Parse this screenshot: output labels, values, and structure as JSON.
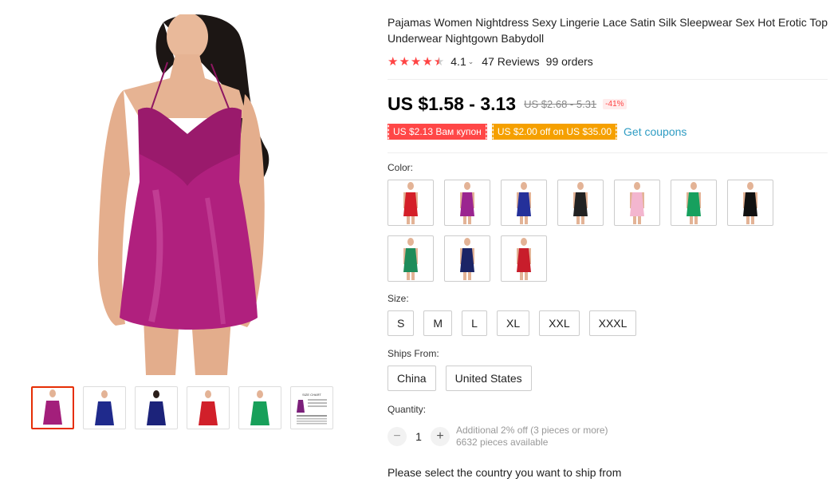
{
  "product": {
    "title": "Pajamas Women Nightdress Sexy Lingerie Lace Satin Silk Sleepwear Sex Hot Erotic Top Underwear Nightgown Babydoll",
    "rating": "4.1",
    "reviews": "47 Reviews",
    "orders": "99 orders",
    "rating_stars_fraction": 0.82,
    "price": "US $1.58 - 3.13",
    "old_price": "US $2.68 - 5.31",
    "discount": "-41%",
    "coupons": [
      "US $2.13 Вам купон",
      "US $2.00 off on US $35.00"
    ],
    "get_coupons": "Get coupons"
  },
  "gallery": {
    "main_color": "#b0207e",
    "thumbnails": [
      {
        "icon": "dress-purple",
        "color": "#a31f7b"
      },
      {
        "icon": "dress-blue",
        "color": "#1f2a8c"
      },
      {
        "icon": "dress-navy-back",
        "color": "#1c237a"
      },
      {
        "icon": "dress-red",
        "color": "#d1202a"
      },
      {
        "icon": "dress-green",
        "color": "#18a05a"
      },
      {
        "icon": "size-chart",
        "color": "#555555"
      }
    ],
    "size_chart_label": "SIZE CHART"
  },
  "color": {
    "label": "Color:",
    "options": [
      {
        "icon": "dress-red",
        "color": "#d41f28"
      },
      {
        "icon": "dress-purple",
        "color": "#9b2590"
      },
      {
        "icon": "dress-blue",
        "color": "#24309a"
      },
      {
        "icon": "dress-black",
        "color": "#222222"
      },
      {
        "icon": "dress-pink",
        "color": "#f3b6cf"
      },
      {
        "icon": "dress-green",
        "color": "#17a05e"
      },
      {
        "icon": "dress-black-2",
        "color": "#111111"
      },
      {
        "icon": "dress-green-lace",
        "color": "#1f8c5a"
      },
      {
        "icon": "dress-navy",
        "color": "#1b2466"
      },
      {
        "icon": "dress-red-2",
        "color": "#c81d2b"
      }
    ]
  },
  "size": {
    "label": "Size:",
    "options": [
      "S",
      "M",
      "L",
      "XL",
      "XXL",
      "XXXL"
    ]
  },
  "ships_from": {
    "label": "Ships From:",
    "options": [
      "China",
      "United States"
    ]
  },
  "quantity": {
    "label": "Quantity:",
    "minus": "−",
    "plus": "+",
    "value": "1",
    "additional": "Additional 2% off (3 pieces or more)",
    "available": "6632 pieces available"
  },
  "ship_message": "Please select the country you want to ship from",
  "colors": {
    "accent_red": "#ff4747",
    "accent_orange": "#f5a000",
    "link": "#2e9cc3",
    "active_border": "#e62e04"
  }
}
